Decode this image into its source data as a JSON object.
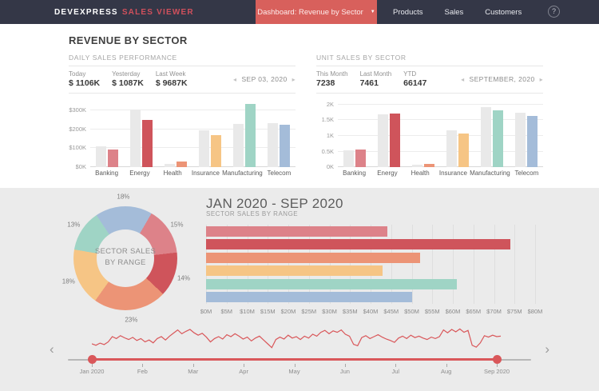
{
  "navbar": {
    "brand_left": "DEVEXPRESS",
    "brand_right": "SALES VIEWER",
    "dashboard_button": "Dashboard: Revenue by Sector",
    "links": [
      "Products",
      "Sales",
      "Customers"
    ],
    "help_label": "?"
  },
  "page_title": "REVENUE BY SECTOR",
  "daily_panel": {
    "title": "DAILY SALES PERFORMANCE",
    "stats": [
      {
        "label": "Today",
        "value": "$ 1106K"
      },
      {
        "label": "Yesterday",
        "value": "$ 1087K"
      },
      {
        "label": "Last Week",
        "value": "$ 9687K"
      }
    ],
    "date_nav": "SEP 03, 2020",
    "prev_icon": "◂",
    "next_icon": "▸"
  },
  "unit_panel": {
    "title": "UNIT SALES BY SECTOR",
    "stats": [
      {
        "label": "This Month",
        "value": "7238"
      },
      {
        "label": "Last Month",
        "value": "7461"
      },
      {
        "label": "YTD",
        "value": "66147"
      }
    ],
    "date_nav": "SEPTEMBER, 2020",
    "prev_icon": "◂",
    "next_icon": "▸"
  },
  "bottom": {
    "heading": "JAN 2020 - SEP 2020"
  },
  "timeline_nav": {
    "prev_icon": "‹",
    "next_icon": "›"
  },
  "colors": {
    "navbar_bg": "#343747",
    "accent_red": "#d8605c",
    "brand_red": "#d0505c",
    "bottom_bg": "#ebebeb",
    "gray_bar": "#e9e9e9",
    "spark_red": "#d9575a"
  },
  "chart_data": [
    {
      "id": "daily_sales_by_sector",
      "type": "bar",
      "title": "DAILY SALES PERFORMANCE",
      "unit": "USD thousands",
      "categories": [
        "Banking",
        "Energy",
        "Health",
        "Insurance",
        "Manufacturing",
        "Telecom"
      ],
      "series": [
        {
          "name": "previous",
          "values": [
            110,
            305,
            15,
            195,
            230,
            232
          ]
        },
        {
          "name": "current",
          "values": [
            93,
            252,
            28,
            172,
            335,
            225
          ]
        }
      ],
      "ylim": [
        0,
        340
      ],
      "yticks": [
        {
          "v": 0,
          "label": "$0K"
        },
        {
          "v": 100,
          "label": "$100K"
        },
        {
          "v": 200,
          "label": "$200K"
        },
        {
          "v": 300,
          "label": "$300K"
        }
      ],
      "colors": {
        "previous": "#e9e9e9",
        "current": [
          "#dd8289",
          "#cf545b",
          "#ec9476",
          "#f6c585",
          "#9fd4c5",
          "#a4bcd9"
        ]
      }
    },
    {
      "id": "unit_sales_by_sector",
      "type": "bar",
      "title": "UNIT SALES BY SECTOR",
      "unit": "units",
      "categories": [
        "Banking",
        "Energy",
        "Health",
        "Insurance",
        "Manufacturing",
        "Telecom"
      ],
      "series": [
        {
          "name": "previous",
          "values": [
            540,
            1680,
            70,
            1170,
            1930,
            1750
          ]
        },
        {
          "name": "current",
          "values": [
            560,
            1730,
            100,
            1080,
            1810,
            1640
          ]
        }
      ],
      "ylim": [
        0,
        2050
      ],
      "yticks": [
        {
          "v": 0,
          "label": "0K"
        },
        {
          "v": 500,
          "label": "0.5K"
        },
        {
          "v": 1000,
          "label": "1K"
        },
        {
          "v": 1500,
          "label": "1.5K"
        },
        {
          "v": 2000,
          "label": "2K"
        }
      ],
      "colors": {
        "previous": "#e9e9e9",
        "current": [
          "#dd8289",
          "#cf545b",
          "#ec9476",
          "#f6c585",
          "#9fd4c5",
          "#a4bcd9"
        ]
      }
    },
    {
      "id": "sector_sales_by_range_donut",
      "type": "pie",
      "center_label": "SECTOR SALES BY RANGE",
      "start_angle": -34,
      "slices": [
        {
          "pct": 18,
          "color": "#a4bcd9"
        },
        {
          "pct": 15,
          "color": "#dd8289"
        },
        {
          "pct": 14,
          "color": "#cf545b"
        },
        {
          "pct": 23,
          "color": "#ec9476"
        },
        {
          "pct": 18,
          "color": "#f6c585"
        },
        {
          "pct": 13,
          "color": "#9fd4c5"
        }
      ]
    },
    {
      "id": "sector_sales_by_range_bars",
      "type": "bar",
      "orientation": "horizontal",
      "subtitle": "SECTOR SALES BY RANGE",
      "unit": "USD millions",
      "xlim": [
        0,
        80
      ],
      "bars": [
        {
          "value": 44,
          "color": "#dd8289"
        },
        {
          "value": 74,
          "color": "#cf545b"
        },
        {
          "value": 52,
          "color": "#ec9476"
        },
        {
          "value": 43,
          "color": "#f6c585"
        },
        {
          "value": 61,
          "color": "#9fd4c5"
        },
        {
          "value": 50,
          "color": "#a4bcd9"
        }
      ],
      "xticks": [
        "$0M",
        "$5M",
        "$10M",
        "$15M",
        "$20M",
        "$25M",
        "$30M",
        "$35M",
        "$40M",
        "$45M",
        "$50M",
        "$55M",
        "$60M",
        "$65M",
        "$70M",
        "$75M",
        "$80M"
      ]
    },
    {
      "id": "range_selector_sparkline",
      "type": "line",
      "months": [
        "Jan 2020",
        "Feb",
        "Mar",
        "Apr",
        "May",
        "Jun",
        "Jul",
        "Aug",
        "Sep 2020"
      ],
      "selected_range": [
        "Jan 2020",
        "Sep 2020"
      ],
      "values": [
        0.3,
        0.24,
        0.33,
        0.27,
        0.38,
        0.6,
        0.52,
        0.64,
        0.55,
        0.48,
        0.57,
        0.44,
        0.52,
        0.38,
        0.46,
        0.34,
        0.52,
        0.6,
        0.46,
        0.62,
        0.75,
        0.88,
        0.72,
        0.82,
        0.9,
        0.76,
        0.66,
        0.74,
        0.58,
        0.38,
        0.52,
        0.6,
        0.5,
        0.68,
        0.6,
        0.72,
        0.62,
        0.5,
        0.58,
        0.42,
        0.54,
        0.62,
        0.46,
        0.3,
        0.14,
        0.48,
        0.58,
        0.5,
        0.66,
        0.54,
        0.6,
        0.48,
        0.62,
        0.54,
        0.7,
        0.62,
        0.78,
        0.86,
        0.72,
        0.84,
        0.78,
        0.88,
        0.7,
        0.62,
        0.28,
        0.22,
        0.56,
        0.64,
        0.52,
        0.6,
        0.68,
        0.58,
        0.5,
        0.44,
        0.36,
        0.54,
        0.62,
        0.52,
        0.66,
        0.56,
        0.62,
        0.54,
        0.48,
        0.58,
        0.52,
        0.6,
        0.88,
        0.76,
        0.9,
        0.8,
        0.92,
        0.78,
        0.86,
        0.24,
        0.16,
        0.34,
        0.64,
        0.58,
        0.66,
        0.6,
        0.62
      ]
    }
  ]
}
